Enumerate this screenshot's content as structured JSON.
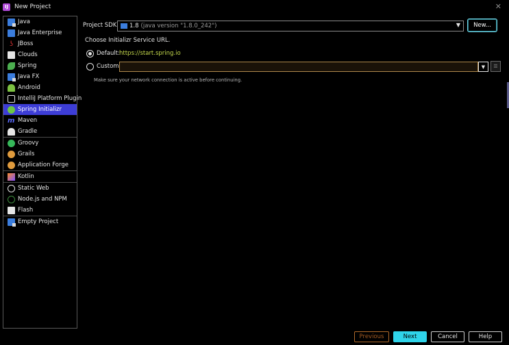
{
  "window": {
    "title": "New Project",
    "close_glyph": "✕"
  },
  "sidebar": {
    "items": [
      {
        "label": "Java",
        "icon": "folder-java-icon"
      },
      {
        "label": "Java Enterprise",
        "icon": "java-enterprise-icon"
      },
      {
        "label": "JBoss",
        "icon": "jboss-icon"
      },
      {
        "label": "Clouds",
        "icon": "clouds-icon"
      },
      {
        "label": "Spring",
        "icon": "spring-icon"
      },
      {
        "label": "Java FX",
        "icon": "folder-javafx-icon"
      },
      {
        "label": "Android",
        "icon": "android-icon"
      },
      {
        "label": "IntelliJ Platform Plugin",
        "icon": "plugin-icon"
      },
      {
        "label": "Spring Initializr",
        "icon": "spring-initializr-icon",
        "selected": true
      },
      {
        "label": "Maven",
        "icon": "maven-icon"
      },
      {
        "label": "Gradle",
        "icon": "gradle-icon"
      },
      {
        "label": "Groovy",
        "icon": "groovy-icon"
      },
      {
        "label": "Grails",
        "icon": "grails-icon"
      },
      {
        "label": "Application Forge",
        "icon": "application-forge-icon"
      },
      {
        "label": "Kotlin",
        "icon": "kotlin-icon"
      },
      {
        "label": "Static Web",
        "icon": "static-web-icon"
      },
      {
        "label": "Node.js and NPM",
        "icon": "nodejs-icon"
      },
      {
        "label": "Flash",
        "icon": "flash-icon"
      },
      {
        "label": "Empty Project",
        "icon": "folder-empty-icon"
      }
    ]
  },
  "main": {
    "sdk_label": "Project SDK:",
    "sdk_version": "1.8",
    "sdk_detail": "(java version \"1.8.0_242\")",
    "new_button": "New...",
    "choose_label": "Choose Initializr Service URL.",
    "default_label": "Default:",
    "default_url": "https://start.spring.io",
    "custom_label": "Custom:",
    "custom_value": "",
    "hint": "Make sure your network connection is active before continuing."
  },
  "footer": {
    "previous": "Previous",
    "next": "Next",
    "cancel": "Cancel",
    "help": "Help"
  },
  "colors": {
    "accent": "#2fd4ea",
    "selection": "#3d3dd6",
    "url": "#c5d94c"
  }
}
